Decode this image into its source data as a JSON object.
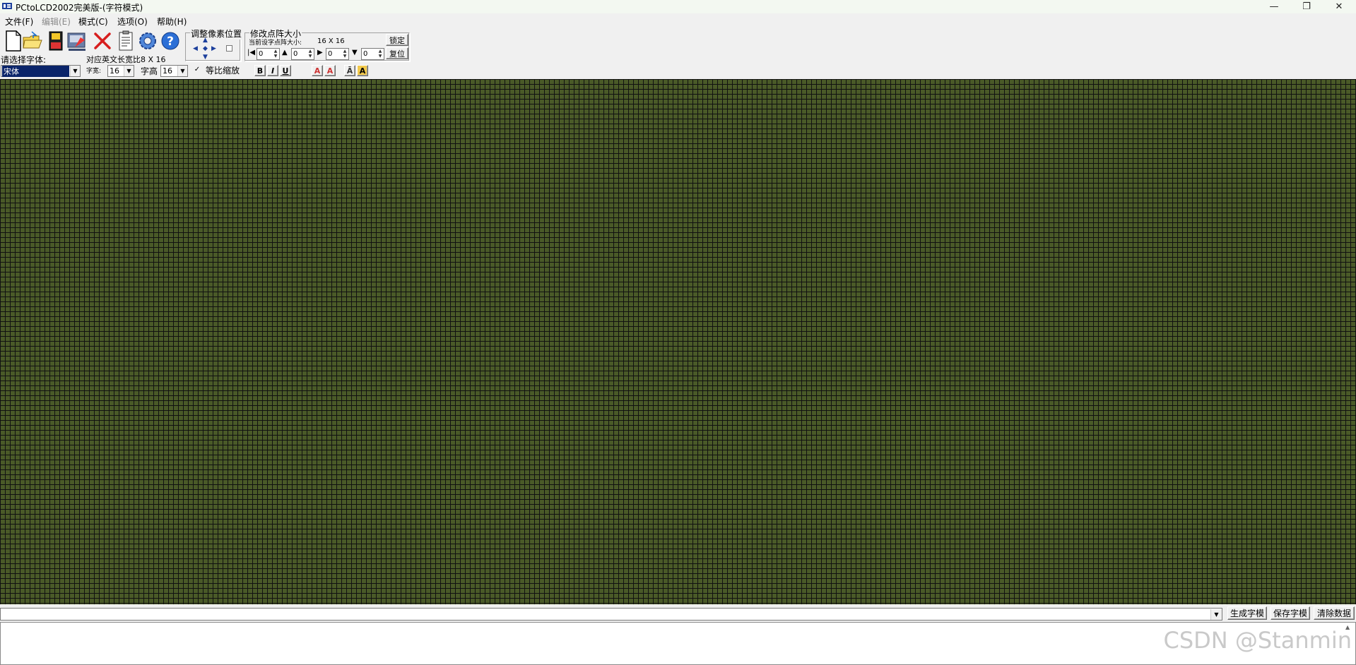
{
  "window": {
    "title": "PCtoLCD2002完美版-(字符模式)",
    "controls": [
      "—",
      "❐",
      "✕"
    ]
  },
  "menu": [
    {
      "label": "文件(F)",
      "enabled": true
    },
    {
      "label": "编辑(E)",
      "enabled": false
    },
    {
      "label": "模式(C)",
      "enabled": true
    },
    {
      "label": "选项(O)",
      "enabled": true
    },
    {
      "label": "帮助(H)",
      "enabled": true
    }
  ],
  "toolbar": {
    "icons": [
      "new-file-icon",
      "open-folder-icon",
      "save-disk-icon",
      "save-as-icon",
      "delete-x-icon",
      "notes-icon",
      "settings-gear-icon",
      "help-question-icon"
    ]
  },
  "pixel_adjust": {
    "title": "调整像素位置"
  },
  "matrix_size": {
    "title": "修改点阵大小",
    "current_label": "当前设字点阵大小:",
    "current_value": "16 X 16",
    "lock_button": "锁定",
    "reset_button": "复位",
    "spins": [
      "0",
      "0",
      "0",
      "0"
    ]
  },
  "font": {
    "select_label": "请选择字体:",
    "font_value": "宋体",
    "ratio_label": "对应英文长宽比8 X 16",
    "width_label": "字宽:",
    "width_value": "16",
    "height_label": "字高",
    "height_value": "16",
    "proportional_label": "等比缩放",
    "proportional_checked": true,
    "bold": "B",
    "italic": "I",
    "underline": "U"
  },
  "bottom": {
    "generate_button": "生成字模",
    "save_button": "保存字模",
    "clear_button": "清除数据",
    "data_value": "",
    "output_text": ""
  },
  "watermark": "CSDN @Stanmin",
  "colors": {
    "grid_cell": "#4a5a28",
    "grid_line": "#111111",
    "title_bar": "#f3f8f1",
    "selection": "#0a246a"
  }
}
